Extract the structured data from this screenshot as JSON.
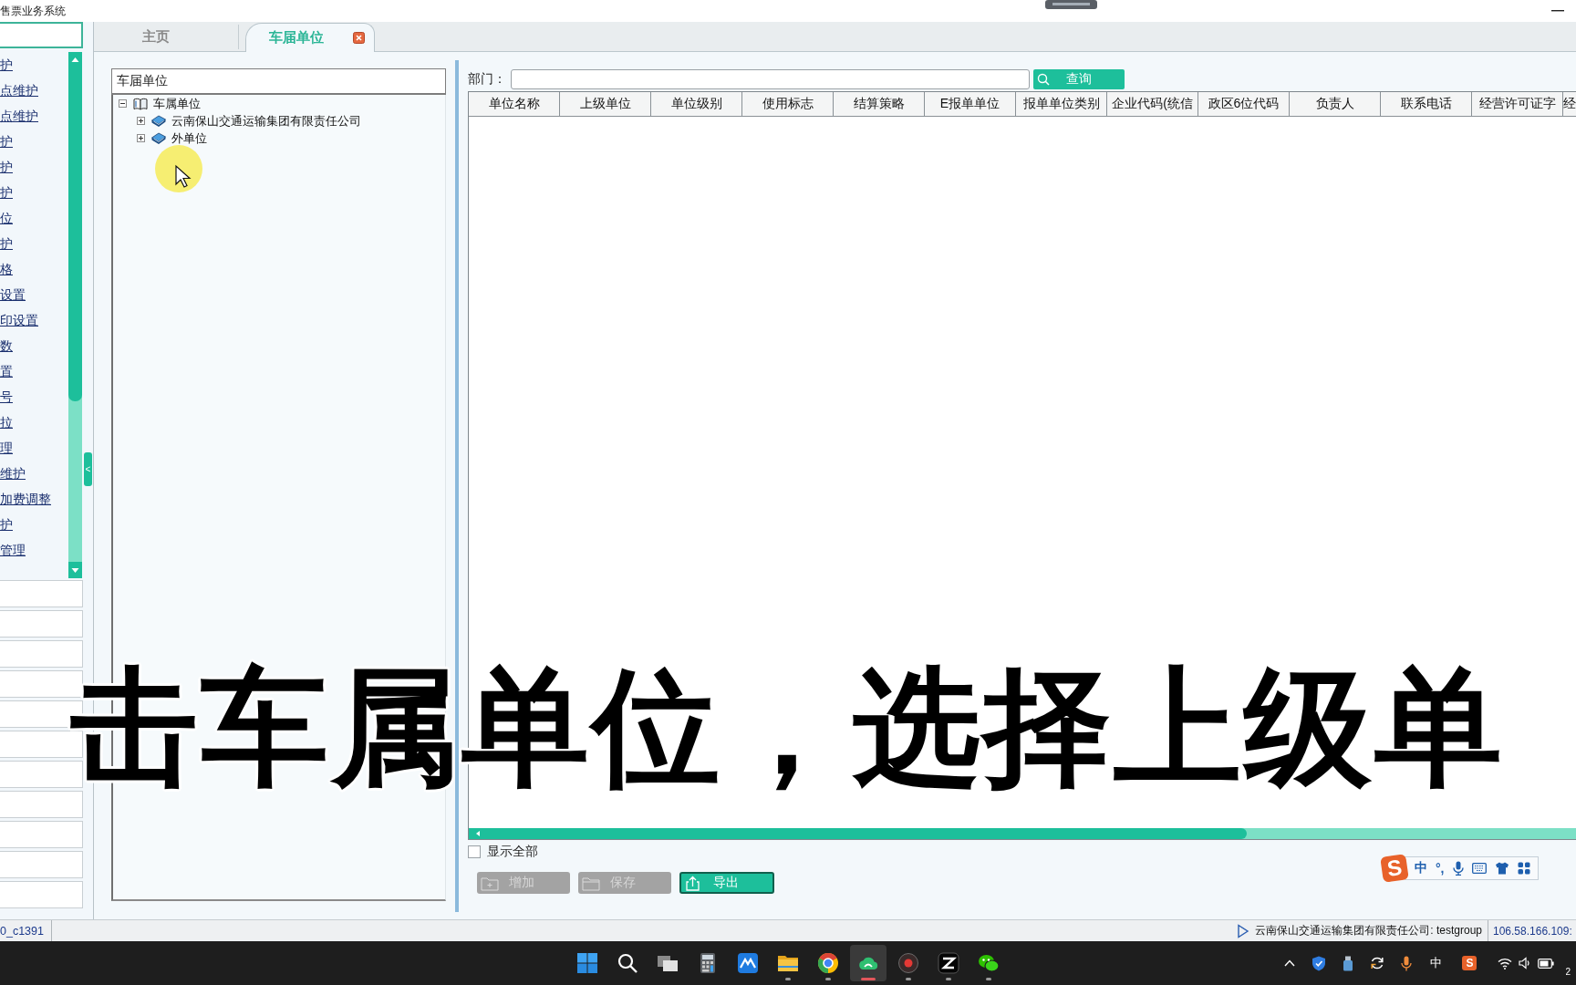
{
  "window": {
    "title": "售票业务系统"
  },
  "sidebar": {
    "items": [
      "护",
      "点维护",
      "点维护",
      "护",
      "护",
      "护",
      "位",
      "护",
      "格",
      "设置",
      "印设置",
      "数",
      "置",
      "号",
      "拉",
      "理",
      "维护",
      "加费调整",
      "护",
      "管理"
    ],
    "collapse_handle": "<"
  },
  "tabs": [
    {
      "label": "主页",
      "selected": false,
      "closable": false
    },
    {
      "label": "车届单位",
      "selected": true,
      "closable": true
    }
  ],
  "tree_panel": {
    "title": "车届单位",
    "tree": [
      {
        "label": "车属单位",
        "kind": "root",
        "expanded": true,
        "children": [
          {
            "label": "云南保山交通运输集团有限责任公司",
            "kind": "unit",
            "expanded": false
          },
          {
            "label": "外单位",
            "kind": "unit",
            "expanded": false
          }
        ]
      }
    ]
  },
  "department_filter": {
    "label": "部门：",
    "button": "查询"
  },
  "table": {
    "columns": [
      "单位名称",
      "上级单位",
      "单位级别",
      "使用标志",
      "结算策略",
      "E报单单位",
      "报单单位类别",
      "企业代码(统信",
      "政区6位代码",
      "负责人",
      "联系电话",
      "经营许可证字",
      "经"
    ]
  },
  "show_all": {
    "label": "显示全部",
    "checked": false
  },
  "buttons": [
    {
      "label": "增加",
      "kind": "add",
      "disabled": true
    },
    {
      "label": "保存",
      "kind": "save",
      "disabled": true
    },
    {
      "label": "导出",
      "kind": "export",
      "disabled": false
    }
  ],
  "caption": "击车属单位，选择上级单",
  "ime_toolbar": {
    "logo": "S",
    "mode": "中",
    "punctuation": "°,"
  },
  "status_bar": {
    "left": "0_c1391",
    "session": "云南保山交通运输集团有限责任公司: testgroup",
    "server": "106.58.166.109:"
  },
  "taskbar": {
    "apps": [
      {
        "kind": "start",
        "running": false,
        "selected": false
      },
      {
        "kind": "search",
        "running": false,
        "selected": false
      },
      {
        "kind": "task_view",
        "running": false,
        "selected": false
      },
      {
        "kind": "calculator",
        "running": false,
        "selected": false
      },
      {
        "kind": "mountain",
        "running": false,
        "selected": false
      },
      {
        "kind": "folder",
        "running": true,
        "selected": false
      },
      {
        "kind": "browser",
        "running": true,
        "selected": false
      },
      {
        "kind": "cloud",
        "running": true,
        "selected": true
      },
      {
        "kind": "recorder",
        "running": true,
        "selected": false
      },
      {
        "kind": "clapper",
        "running": true,
        "selected": false
      },
      {
        "kind": "chat",
        "running": true,
        "selected": false
      }
    ],
    "tray": {
      "ime": "中",
      "ime_logo": "S",
      "clock": "2"
    }
  }
}
